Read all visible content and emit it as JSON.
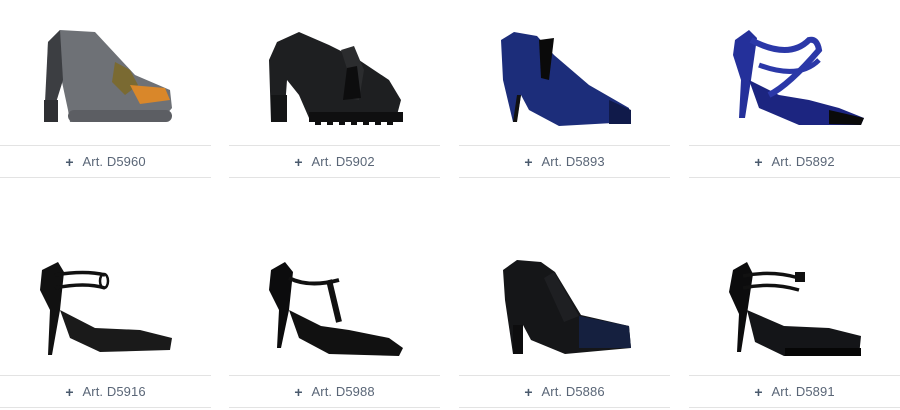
{
  "products": [
    {
      "label": "Art. D5960",
      "icon": "plus-icon",
      "image": "grey-platform-loafer-pump-image"
    },
    {
      "label": "Art. D5902",
      "icon": "plus-icon",
      "image": "black-tassel-loafer-pump-image"
    },
    {
      "label": "Art. D5893",
      "icon": "plus-icon",
      "image": "navy-suede-ankle-bootie-image"
    },
    {
      "label": "Art. D5892",
      "icon": "plus-icon",
      "image": "blue-crossstrap-pump-image"
    },
    {
      "label": "Art. D5916",
      "icon": "plus-icon",
      "image": "black-doublestrap-pump-image"
    },
    {
      "label": "Art. D5988",
      "icon": "plus-icon",
      "image": "black-patent-tstrap-pump-image"
    },
    {
      "label": "Art. D5886",
      "icon": "plus-icon",
      "image": "black-elastic-bootie-image"
    },
    {
      "label": "Art. D5891",
      "icon": "plus-icon",
      "image": "black-suede-strappy-pump-image"
    }
  ],
  "colors": {
    "label_text": "#5a6677",
    "divider": "#e3e3e3",
    "background": "#ffffff"
  }
}
